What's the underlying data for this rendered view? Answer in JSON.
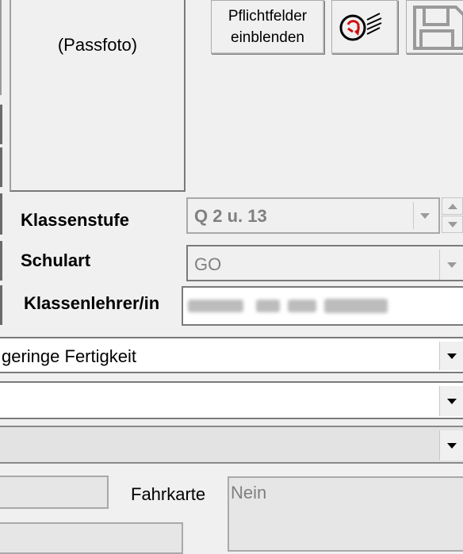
{
  "photo": {
    "label": "(Passfoto)"
  },
  "toolbar": {
    "pflicht_line1": "Pflichtfelder",
    "pflicht_line2": "einblenden"
  },
  "fields": {
    "klassenstufe": {
      "label": "Klassenstufe",
      "value": "Q 2 u. 13"
    },
    "schulart": {
      "label": "Schulart",
      "value": "GO"
    },
    "klassenlehrer": {
      "label": "Klassenlehrer/in",
      "value": ""
    }
  },
  "dropdowns": {
    "fertigkeit": {
      "value": "geringe Fertigkeit"
    }
  },
  "fahrkarte": {
    "label": "Fahrkarte",
    "value": "Nein"
  }
}
